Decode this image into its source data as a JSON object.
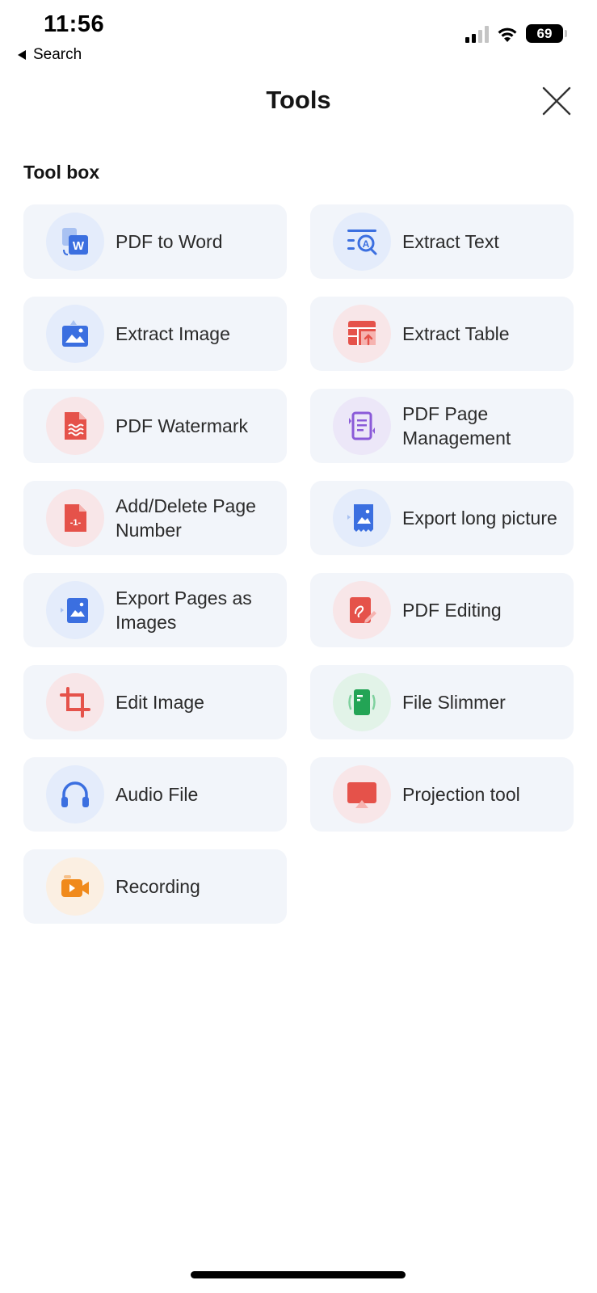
{
  "status_bar": {
    "time": "11:56",
    "back_label": "Search",
    "battery": "69"
  },
  "header": {
    "title": "Tools",
    "close_icon": "close-icon"
  },
  "section": {
    "title": "Tool box"
  },
  "tools": [
    {
      "id": "pdf-to-word",
      "label": "PDF to Word",
      "icon": "pdf-to-word-icon",
      "color": "#3b6fe0",
      "bg": "#e4ecfb"
    },
    {
      "id": "extract-text",
      "label": "Extract Text",
      "icon": "extract-text-icon",
      "color": "#3b6fe0",
      "bg": "#e4ecfb"
    },
    {
      "id": "extract-image",
      "label": "Extract Image",
      "icon": "extract-image-icon",
      "color": "#3b6fe0",
      "bg": "#e4ecfb"
    },
    {
      "id": "extract-table",
      "label": "Extract Table",
      "icon": "extract-table-icon",
      "color": "#e5524a",
      "bg": "#f8e6e8"
    },
    {
      "id": "pdf-watermark",
      "label": "PDF Watermark",
      "icon": "watermark-icon",
      "color": "#e5524a",
      "bg": "#f8e6e8"
    },
    {
      "id": "pdf-page-management",
      "label": "PDF Page Management",
      "icon": "page-management-icon",
      "color": "#8a5ad8",
      "bg": "#ece7f8"
    },
    {
      "id": "add-delete-page-number",
      "label": "Add/Delete Page Number",
      "icon": "page-number-icon",
      "color": "#e5524a",
      "bg": "#f8e6e8"
    },
    {
      "id": "export-long-picture",
      "label": "Export long picture",
      "icon": "long-picture-icon",
      "color": "#3b6fe0",
      "bg": "#e4ecfb"
    },
    {
      "id": "export-pages-as-images",
      "label": "Export Pages as Images",
      "icon": "export-images-icon",
      "color": "#3b6fe0",
      "bg": "#e4ecfb"
    },
    {
      "id": "pdf-editing",
      "label": "PDF Editing",
      "icon": "pdf-edit-icon",
      "color": "#e5524a",
      "bg": "#f8e6e8"
    },
    {
      "id": "edit-image",
      "label": "Edit Image",
      "icon": "crop-icon",
      "color": "#e5524a",
      "bg": "#f8e6e8"
    },
    {
      "id": "file-slimmer",
      "label": "File Slimmer",
      "icon": "file-slimmer-icon",
      "color": "#23a455",
      "bg": "#e2f3e8"
    },
    {
      "id": "audio-file",
      "label": "Audio File",
      "icon": "headphones-icon",
      "color": "#3b6fe0",
      "bg": "#e4ecfb"
    },
    {
      "id": "projection-tool",
      "label": "Projection tool",
      "icon": "projection-icon",
      "color": "#e5524a",
      "bg": "#f8e6e8"
    },
    {
      "id": "recording",
      "label": "Recording",
      "icon": "video-camera-icon",
      "color": "#f08a1c",
      "bg": "#fbefe2"
    }
  ]
}
